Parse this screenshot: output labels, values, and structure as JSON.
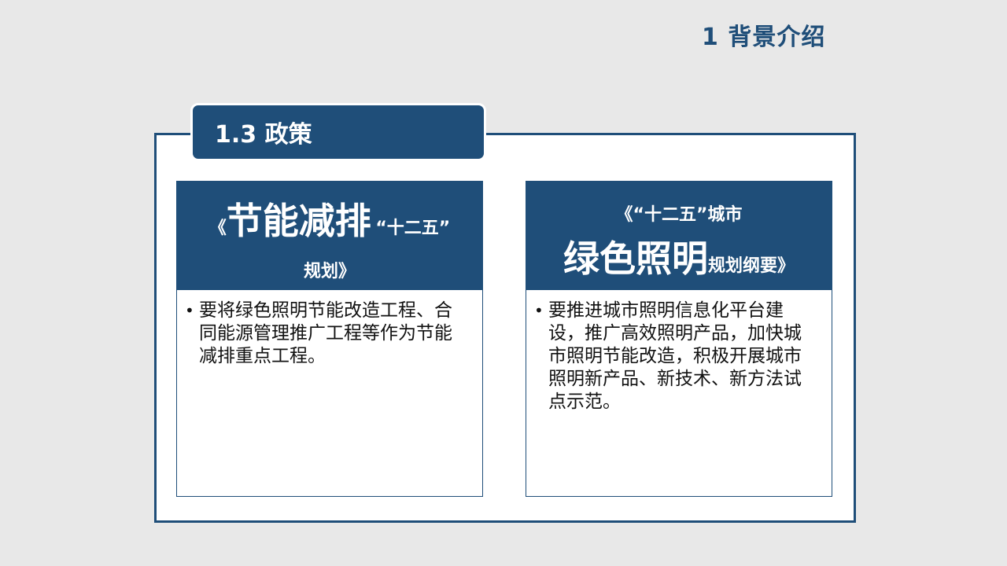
{
  "slide": {
    "title": "1 背景介绍"
  },
  "section": {
    "title": "1.3 政策"
  },
  "cards": [
    {
      "header": {
        "open_bracket": "《",
        "main": "节能减排",
        "suffix": "“十二五”",
        "line2": "规划》"
      },
      "bullet": "•",
      "body": "要将绿色照明节能改造工程、合同能源管理推广工程等作为节能减排重点工程。"
    },
    {
      "header": {
        "line1": "《“十二五”城市",
        "main": "绿色照明",
        "suffix": "规划纲要》"
      },
      "bullet": "•",
      "body": "要推进城市照明信息化平台建设，推广高效照明产品，加快城市照明节能改造，积极开展城市照明新产品、新技术、新方法试点示范。"
    }
  ]
}
